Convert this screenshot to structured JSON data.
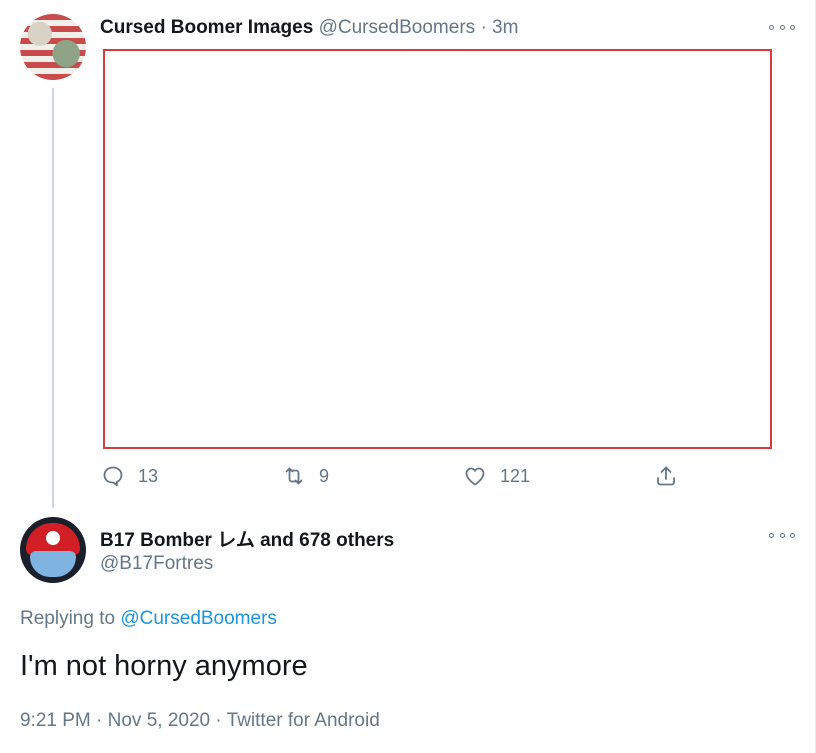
{
  "original_tweet": {
    "display_name": "Cursed Boomer Images",
    "handle": "@CursedBoomers",
    "separator": "·",
    "time_ago": "3m",
    "actions": {
      "reply_count": "13",
      "retweet_count": "9",
      "like_count": "121"
    }
  },
  "reply_tweet": {
    "display_name": "B17 Bomber レム and 678 others",
    "handle": "@B17Fortres",
    "replying_prefix": "Replying to",
    "replying_handle": "@CursedBoomers",
    "text": "I'm not horny anymore",
    "timestamp": "9:21 PM · Nov 5, 2020",
    "separator": "·",
    "source": "Twitter for Android"
  },
  "colors": {
    "text": "#14171a",
    "muted": "#657786",
    "link": "#1b95e0",
    "media_border": "#d93a3a",
    "thread_line": "#ccd6dd"
  },
  "icons": {
    "reply": "reply-icon",
    "retweet": "retweet-icon",
    "like": "heart-icon",
    "share": "share-icon",
    "more": "more-options-icon"
  }
}
